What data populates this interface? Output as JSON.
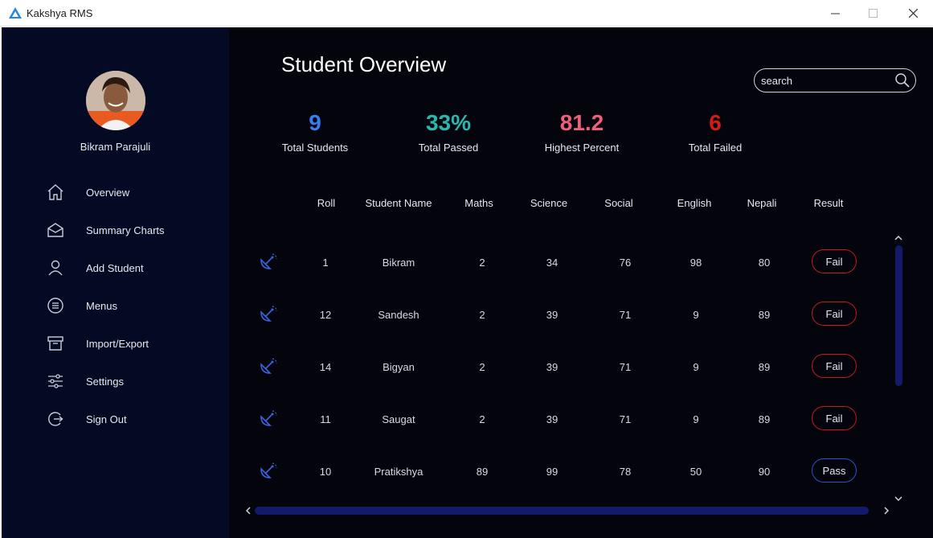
{
  "app": {
    "title": "Kakshya RMS"
  },
  "sidebar": {
    "user_name": "Bikram Parajuli",
    "items": [
      {
        "label": "Overview",
        "icon": "home-icon"
      },
      {
        "label": "Summary Charts",
        "icon": "envelope-icon"
      },
      {
        "label": "Add Student",
        "icon": "user-icon"
      },
      {
        "label": "Menus",
        "icon": "list-circle-icon"
      },
      {
        "label": "Import/Export",
        "icon": "archive-icon"
      },
      {
        "label": "Settings",
        "icon": "sliders-icon"
      },
      {
        "label": "Sign Out",
        "icon": "sign-out-icon"
      }
    ]
  },
  "main": {
    "title": "Student Overview",
    "search": {
      "placeholder": "search"
    },
    "stats": [
      {
        "value": "9",
        "label": "Total Students",
        "color": "#3b7cf0"
      },
      {
        "value": "33%",
        "label": "Total Passed",
        "color": "#2ab7b0"
      },
      {
        "value": "81.2",
        "label": "Highest Percent",
        "color": "#ef5f7c"
      },
      {
        "value": "6",
        "label": "Total Failed",
        "color": "#d61a1a"
      }
    ],
    "columns": [
      "Roll",
      "Student Name",
      "Maths",
      "Science",
      "Social",
      "English",
      "Nepali",
      "Result"
    ],
    "rows": [
      {
        "roll": "1",
        "name": "Bikram",
        "maths": "2",
        "science": "34",
        "social": "76",
        "english": "98",
        "nepali": "80",
        "result": "Fail"
      },
      {
        "roll": "12",
        "name": "Sandesh",
        "maths": "2",
        "science": "39",
        "social": "71",
        "english": "9",
        "nepali": "89",
        "result": "Fail"
      },
      {
        "roll": "14",
        "name": "Bigyan",
        "maths": "2",
        "science": "39",
        "social": "71",
        "english": "9",
        "nepali": "89",
        "result": "Fail"
      },
      {
        "roll": "11",
        "name": "Saugat",
        "maths": "2",
        "science": "39",
        "social": "71",
        "english": "9",
        "nepali": "89",
        "result": "Fail"
      },
      {
        "roll": "10",
        "name": "Pratikshya",
        "maths": "89",
        "science": "99",
        "social": "78",
        "english": "50",
        "nepali": "90",
        "result": "Pass"
      }
    ]
  },
  "colors": {
    "sidebar_bg": "#050a24",
    "main_bg": "#03040c",
    "accent": "#131a6a",
    "fail": "#c01a1a",
    "pass": "#2a55c8",
    "icon": "#3b64e0"
  }
}
